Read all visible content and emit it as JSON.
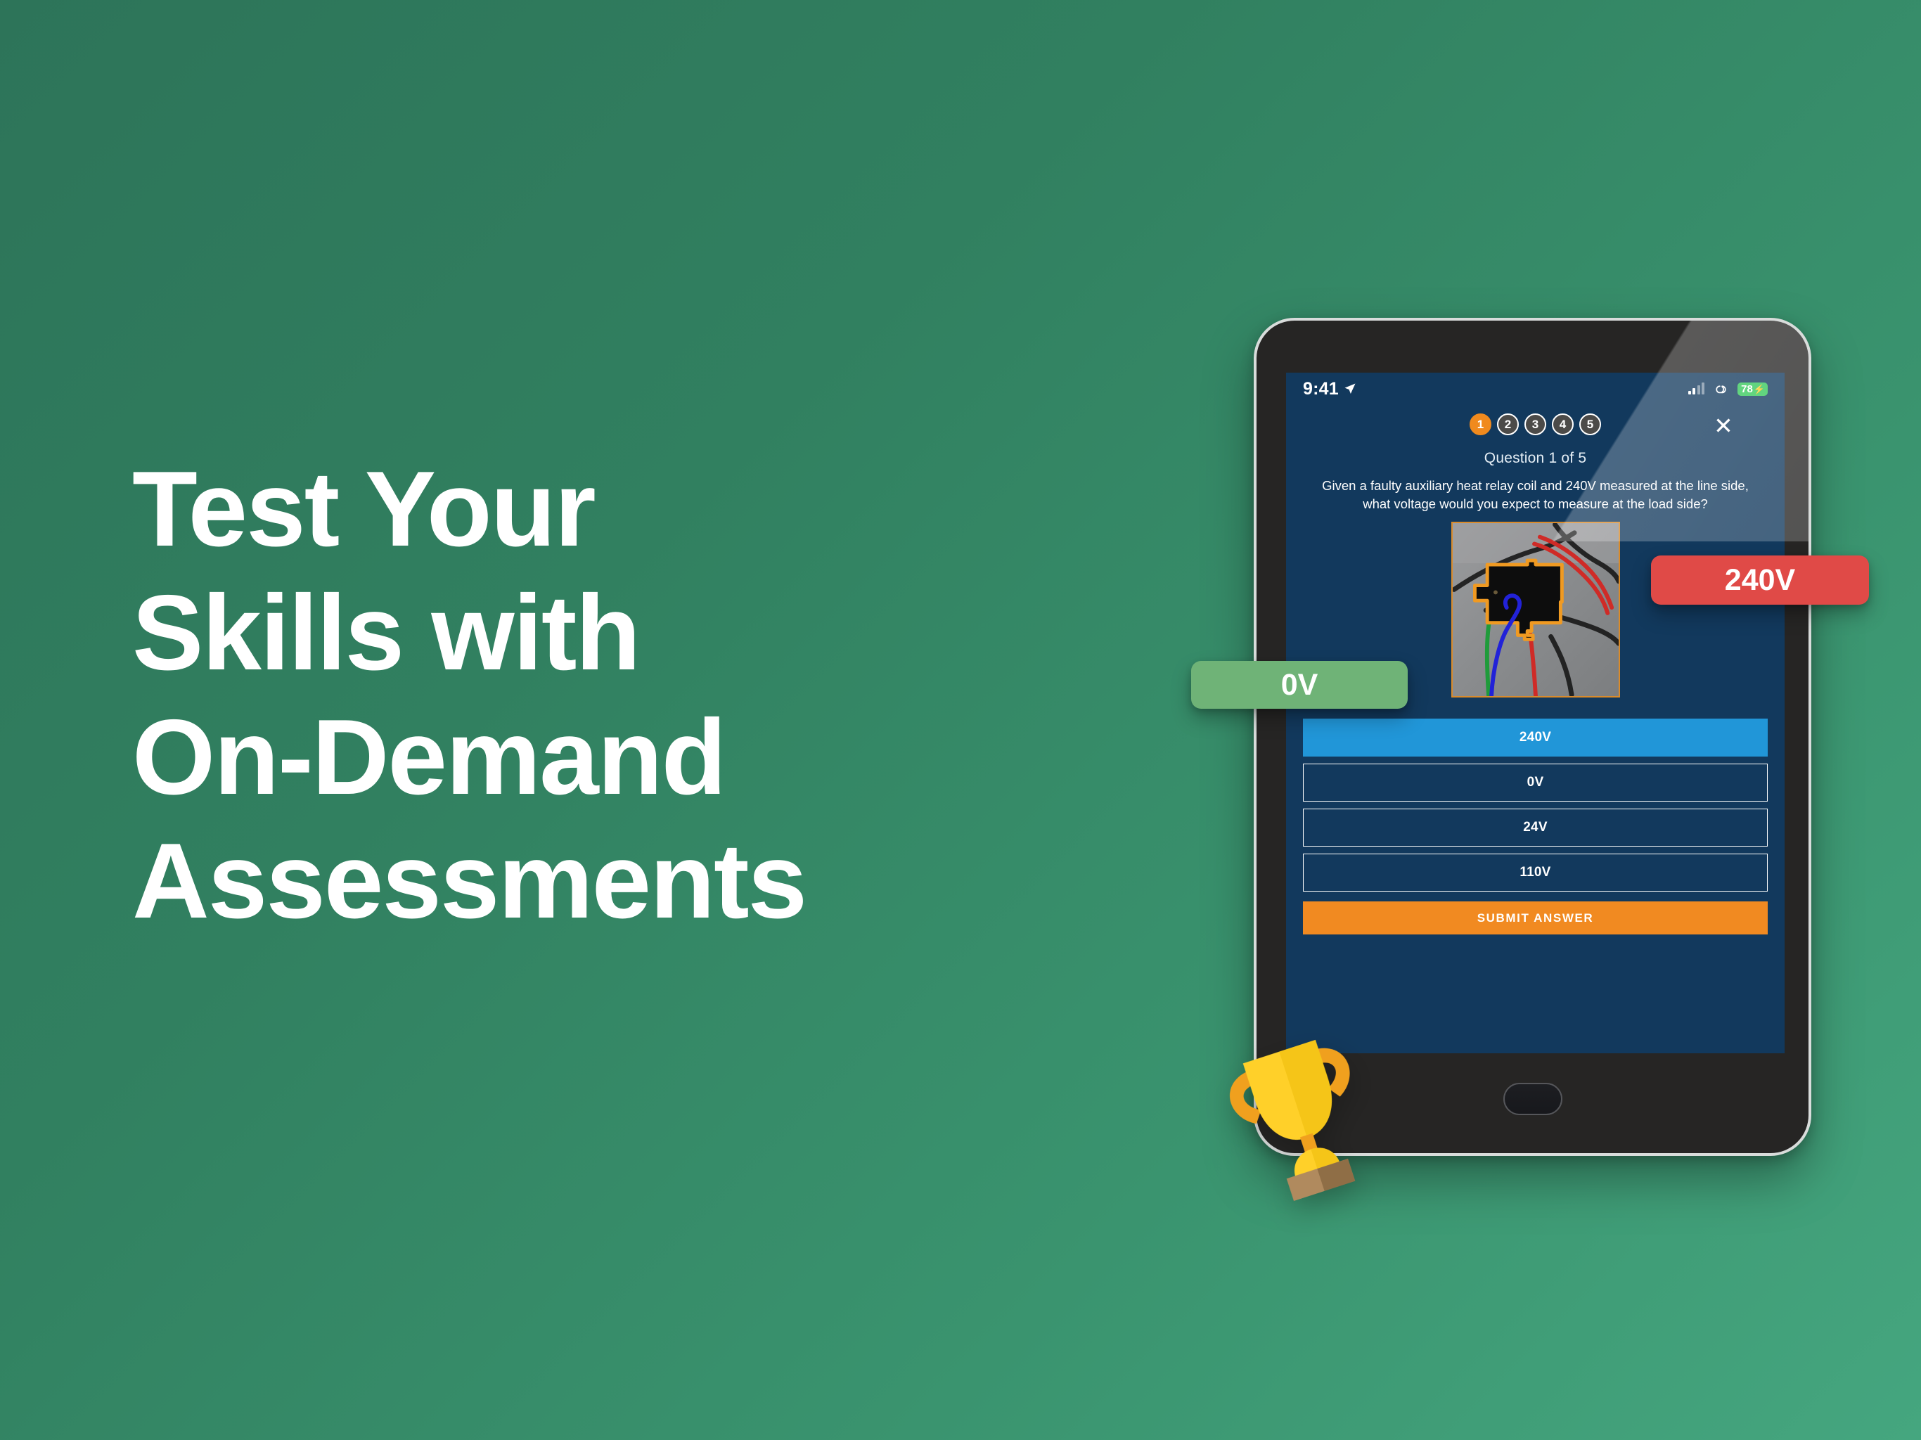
{
  "theme": {
    "background_green_top": "#2d7459",
    "background_green_bottom": "#45a67f",
    "screen_navy": "#12395d",
    "accent_orange": "#f08a1e",
    "submit_orange": "#f18a21",
    "selected_blue": "#2196d8",
    "badge_green": "#6fb377",
    "badge_red": "#e04a47",
    "battery_green": "#34c759",
    "relay_outline_orange": "#d98b2b"
  },
  "headline": {
    "lines": [
      "Test Your",
      "Skills with",
      "On-Demand",
      "Assessments"
    ]
  },
  "tablet": {
    "statusbar": {
      "clock": "9:41",
      "location_icon": "location-arrow-icon",
      "signal_icon": "cellular-signal-icon",
      "wifi_icon": "wifi-link-icon",
      "battery_level": "78",
      "battery_bolt": "charging-bolt-icon"
    },
    "quiz": {
      "steps": [
        {
          "label": "1",
          "active": true
        },
        {
          "label": "2",
          "active": false
        },
        {
          "label": "3",
          "active": false
        },
        {
          "label": "4",
          "active": false
        },
        {
          "label": "5",
          "active": false
        }
      ],
      "close_label": "✕",
      "counter": "Question 1 of 5",
      "question": "Given a faulty auxiliary heat relay coil and 240V measured at the line side, what voltage would you expect to measure at the load side?",
      "figure": {
        "name": "relay-wiring-photo",
        "description": "Photo of a black auxiliary heat relay outlined in orange with green, blue, red and black wires"
      },
      "options": [
        {
          "label": "240V",
          "selected": true
        },
        {
          "label": "0V",
          "selected": false
        },
        {
          "label": "24V",
          "selected": false
        },
        {
          "label": "110V",
          "selected": false
        }
      ],
      "submit_label": "SUBMIT ANSWER"
    }
  },
  "badges": [
    {
      "name": "badge-0v",
      "label": "0V",
      "color": "#6fb377"
    },
    {
      "name": "badge-240v",
      "label": "240V",
      "color": "#e04a47"
    }
  ],
  "decor": {
    "trophy_icon": "trophy-icon"
  }
}
